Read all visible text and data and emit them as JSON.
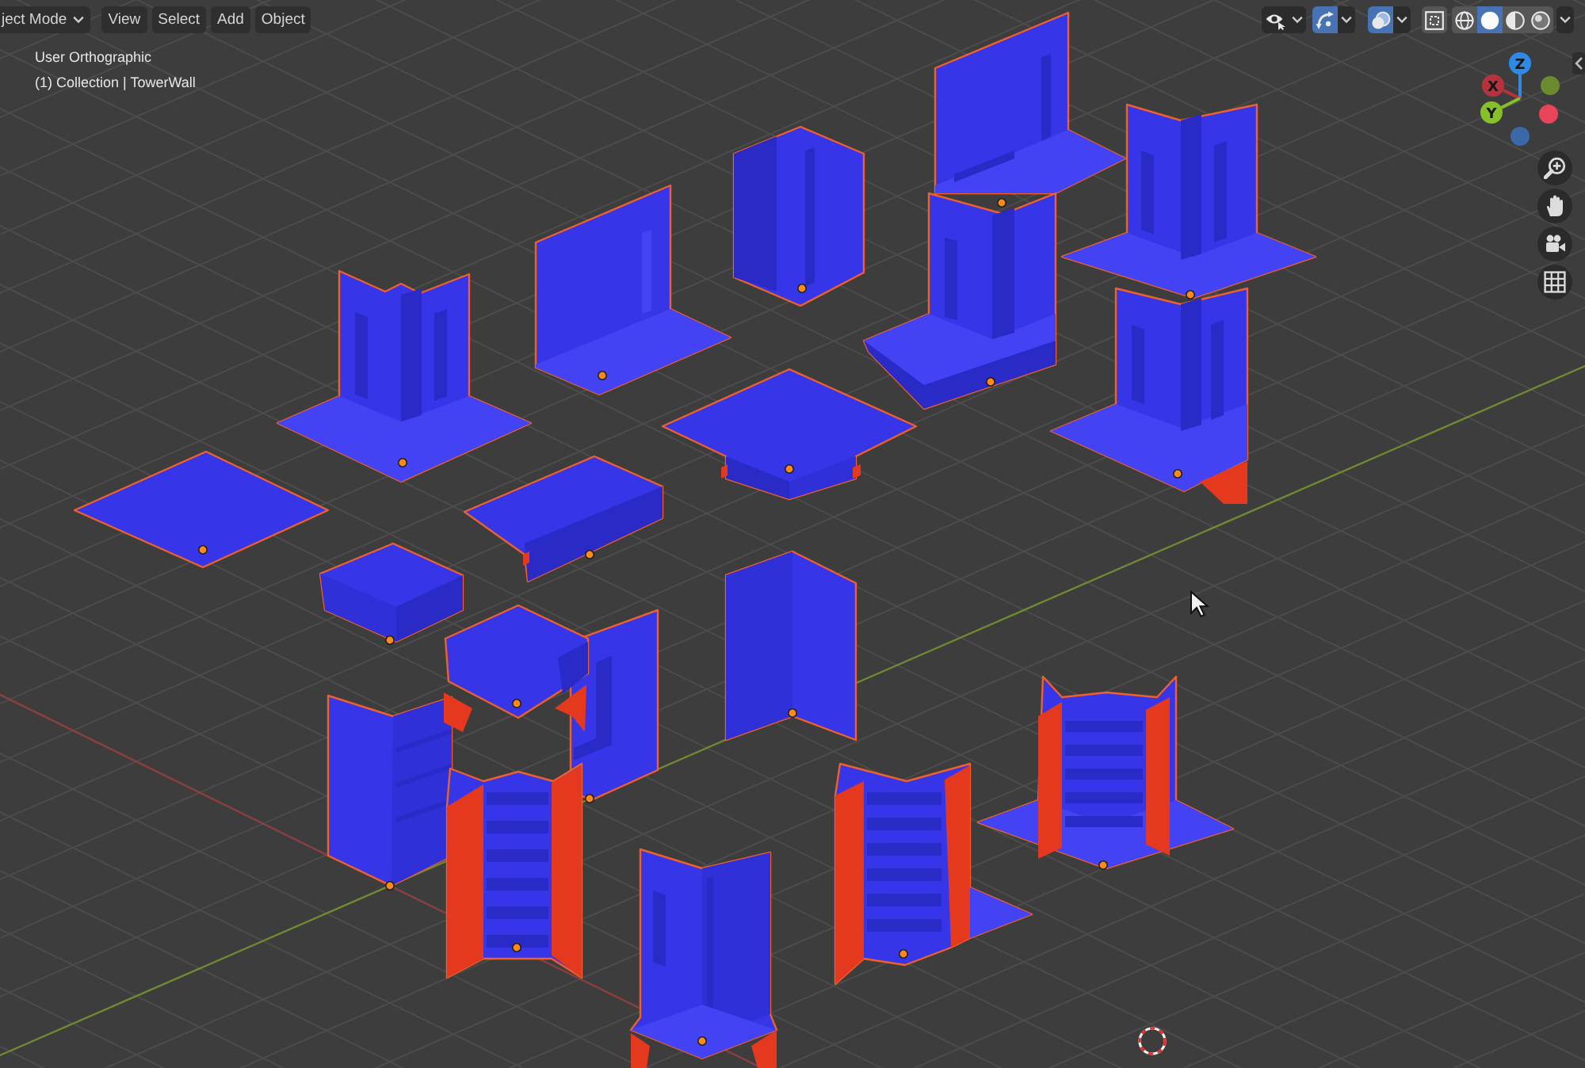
{
  "header": {
    "menus": [
      {
        "label": "ject Mode",
        "kind": "dropdown"
      },
      {
        "label": "View",
        "kind": "menu"
      },
      {
        "label": "Select",
        "kind": "menu"
      },
      {
        "label": "Add",
        "kind": "menu"
      },
      {
        "label": "Object",
        "kind": "menu"
      }
    ]
  },
  "viewport_info": {
    "view_name": "User Orthographic",
    "collection": "(1) Collection | TowerWall"
  },
  "toolbar": [
    {
      "kind": "visibility",
      "on": false,
      "dropdown": true
    },
    {
      "kind": "gizmos",
      "on": true,
      "dropdown": true
    },
    {
      "kind": "overlays",
      "on": true,
      "dropdown": true
    },
    {
      "kind": "xray",
      "on": false
    }
  ],
  "shading": {
    "modes": [
      {
        "kind": "wireframe",
        "selected": false
      },
      {
        "kind": "solid",
        "selected": true
      },
      {
        "kind": "material",
        "selected": false
      },
      {
        "kind": "rendered",
        "selected": false
      }
    ],
    "dropdown": true
  },
  "gizmo": {
    "axes": [
      {
        "label": "Z",
        "color": "#2e8ae6"
      },
      {
        "label": "X",
        "color": "#b8323e"
      },
      {
        "label": "Y",
        "color": "#86c12a"
      }
    ]
  },
  "navigation": [
    {
      "kind": "zoom"
    },
    {
      "kind": "pan"
    },
    {
      "kind": "camera"
    },
    {
      "kind": "grid"
    }
  ],
  "scene": {
    "objects": [
      {
        "selected": true
      },
      {
        "selected": true
      },
      {
        "selected": true
      },
      {
        "selected": true
      },
      {
        "selected": true
      },
      {
        "selected": true
      },
      {
        "selected": true
      },
      {
        "selected": true
      },
      {
        "selected": true
      },
      {
        "selected": true
      },
      {
        "selected": true
      },
      {
        "selected": true
      },
      {
        "selected": true
      },
      {
        "selected": true
      },
      {
        "selected": true
      },
      {
        "selected": true
      },
      {
        "selected": true
      },
      {
        "selected": true
      },
      {
        "selected": true
      }
    ]
  }
}
